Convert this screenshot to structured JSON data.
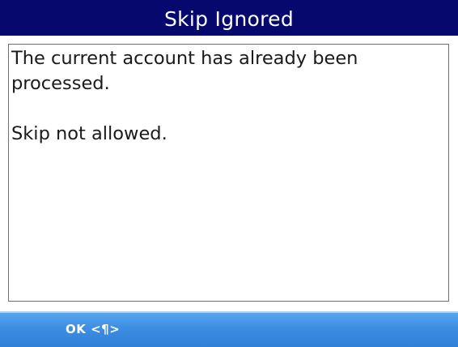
{
  "dialog": {
    "title": "Skip Ignored",
    "message_line_1": "The current account has already been",
    "message_line_2": "processed.",
    "message_line_3": "Skip not allowed."
  },
  "softkeys": {
    "left_label": "OK <¶>"
  },
  "colors": {
    "title_bar": "#06086e",
    "softkey_bar": "#3d8fe4",
    "border": "#6f6f6f"
  }
}
